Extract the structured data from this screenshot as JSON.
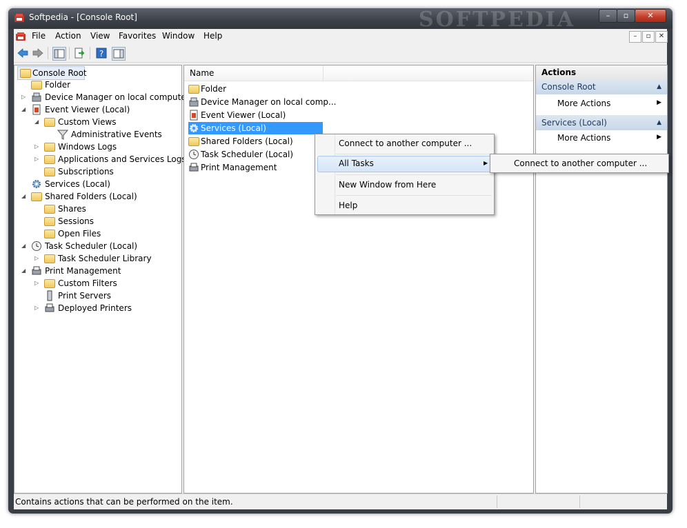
{
  "window": {
    "title": "Softpedia - [Console Root]",
    "watermark": "SOFTPEDIA",
    "controls": [
      "–",
      "▫",
      "✕"
    ]
  },
  "menubar": {
    "items": [
      "File",
      "Action",
      "View",
      "Favorites",
      "Window",
      "Help"
    ],
    "mdi_controls": [
      "–",
      "▫",
      "✕"
    ]
  },
  "toolbar": {
    "icons": [
      "back-icon",
      "forward-icon",
      "show-hide-tree-icon",
      "export-list-icon",
      "help-icon",
      "show-hide-action-pane-icon"
    ]
  },
  "tree": {
    "items": [
      {
        "label": "Console Root"
      },
      {
        "label": "Folder"
      },
      {
        "label": "Device Manager on local computer"
      },
      {
        "label": "Event Viewer (Local)"
      },
      {
        "label": "Custom Views"
      },
      {
        "label": "Administrative Events"
      },
      {
        "label": "Windows Logs"
      },
      {
        "label": "Applications and Services Logs"
      },
      {
        "label": "Subscriptions"
      },
      {
        "label": "Services (Local)"
      },
      {
        "label": "Shared Folders (Local)"
      },
      {
        "label": "Shares"
      },
      {
        "label": "Sessions"
      },
      {
        "label": "Open Files"
      },
      {
        "label": "Task Scheduler (Local)"
      },
      {
        "label": "Task Scheduler Library"
      },
      {
        "label": "Print Management"
      },
      {
        "label": "Custom Filters"
      },
      {
        "label": "Print Servers"
      },
      {
        "label": "Deployed Printers"
      }
    ]
  },
  "list": {
    "column_header": "Name",
    "items": [
      {
        "label": "Folder"
      },
      {
        "label": "Device Manager on local comp..."
      },
      {
        "label": "Event Viewer (Local)"
      },
      {
        "label": "Services (Local)",
        "selected": true
      },
      {
        "label": "Shared Folders (Local)"
      },
      {
        "label": "Task Scheduler (Local)"
      },
      {
        "label": "Print Management"
      }
    ]
  },
  "actions": {
    "title": "Actions",
    "sections": [
      {
        "name": "Console Root",
        "items": [
          "More Actions"
        ]
      },
      {
        "name": "Services (Local)",
        "items": [
          "More Actions"
        ]
      }
    ]
  },
  "context_menu": {
    "items": [
      "Connect to another computer ...",
      "All Tasks",
      "New Window from Here",
      "Help"
    ],
    "submenu_items": [
      "Connect to another computer ..."
    ]
  },
  "statusbar": {
    "text": "Contains actions that can be performed on the item."
  },
  "colors": {
    "selection": "#3399ff",
    "accent": "#c4402c"
  }
}
